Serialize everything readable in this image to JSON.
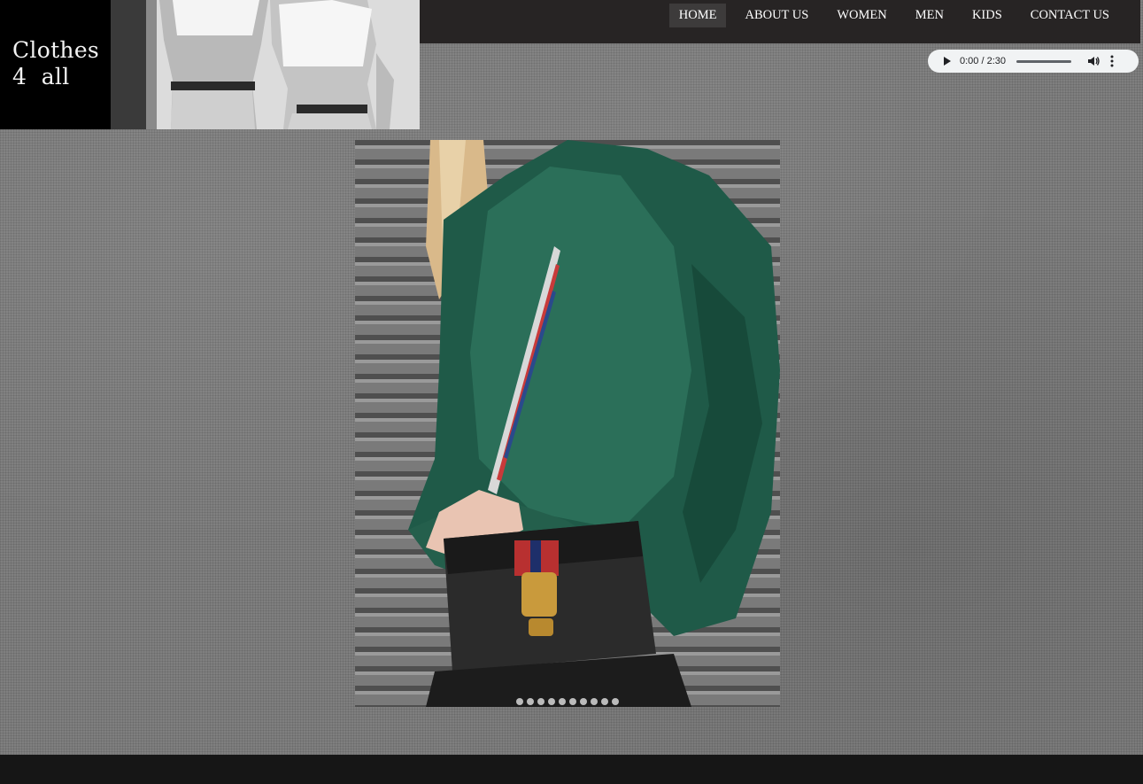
{
  "logo": {
    "line1": "Clothes",
    "line2": "4  all"
  },
  "nav": {
    "items": [
      "HOME",
      "ABOUT US",
      "WOMEN",
      "MEN",
      "KIDS",
      "CONTACT US"
    ],
    "active": "HOME"
  },
  "audio": {
    "time": "0:00 / 2:30",
    "progress": 0
  },
  "slideshow": {
    "dot_count": 10,
    "active_dot": 0
  },
  "icons": {
    "play": "play-icon",
    "volume": "volume-icon",
    "more": "more-vertical-icon"
  },
  "colors": {
    "header_bg": "#272424",
    "nav_active_bg": "#3d3b3b",
    "coat_green": "#1f5a48",
    "footer_bg": "#161616"
  }
}
